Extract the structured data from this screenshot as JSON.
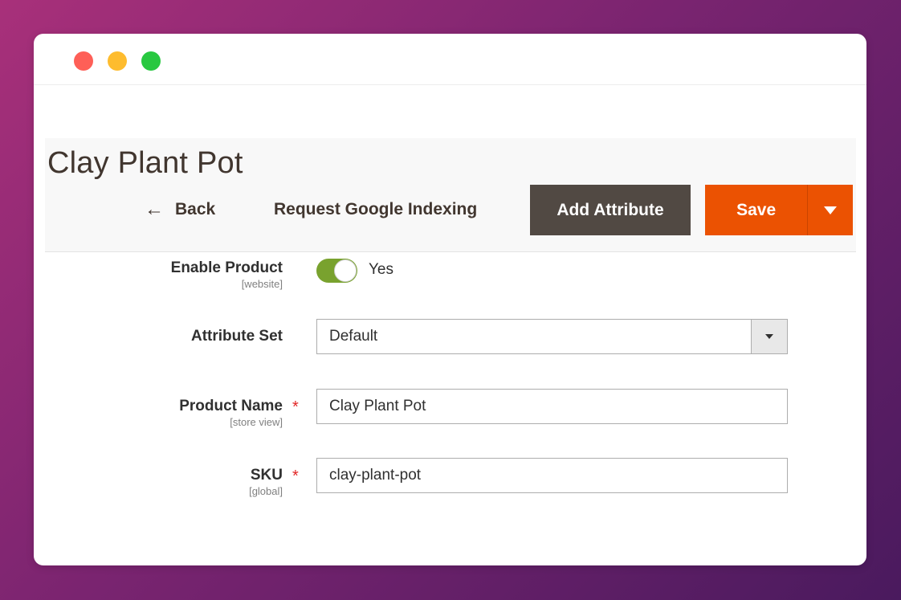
{
  "window": {
    "controls": {
      "close": {
        "icon": "close-dot",
        "color": "#fe5f57"
      },
      "minimize": {
        "icon": "minimize-dot",
        "color": "#febc2e"
      },
      "maximize": {
        "icon": "maximize-dot",
        "color": "#28c840"
      }
    }
  },
  "header": {
    "title": "Clay Plant Pot",
    "back_label": "Back",
    "back_icon": "←",
    "google_indexing_label": "Request Google Indexing",
    "add_attribute_label": "Add Attribute",
    "save_label": "Save"
  },
  "form": {
    "enable_product": {
      "label": "Enable Product",
      "scope": "[website]",
      "value": "Yes",
      "enabled": true
    },
    "attribute_set": {
      "label": "Attribute Set",
      "selected": "Default"
    },
    "product_name": {
      "label": "Product Name",
      "scope": "[store view]",
      "required_mark": "*",
      "value": "Clay Plant Pot"
    },
    "sku": {
      "label": "SKU",
      "scope": "[global]",
      "required_mark": "*",
      "value": "clay-plant-pot"
    }
  },
  "colors": {
    "accent_save": "#eb5202",
    "secondary_button": "#514943",
    "toggle_on": "#79a22e",
    "required": "#e22626"
  }
}
